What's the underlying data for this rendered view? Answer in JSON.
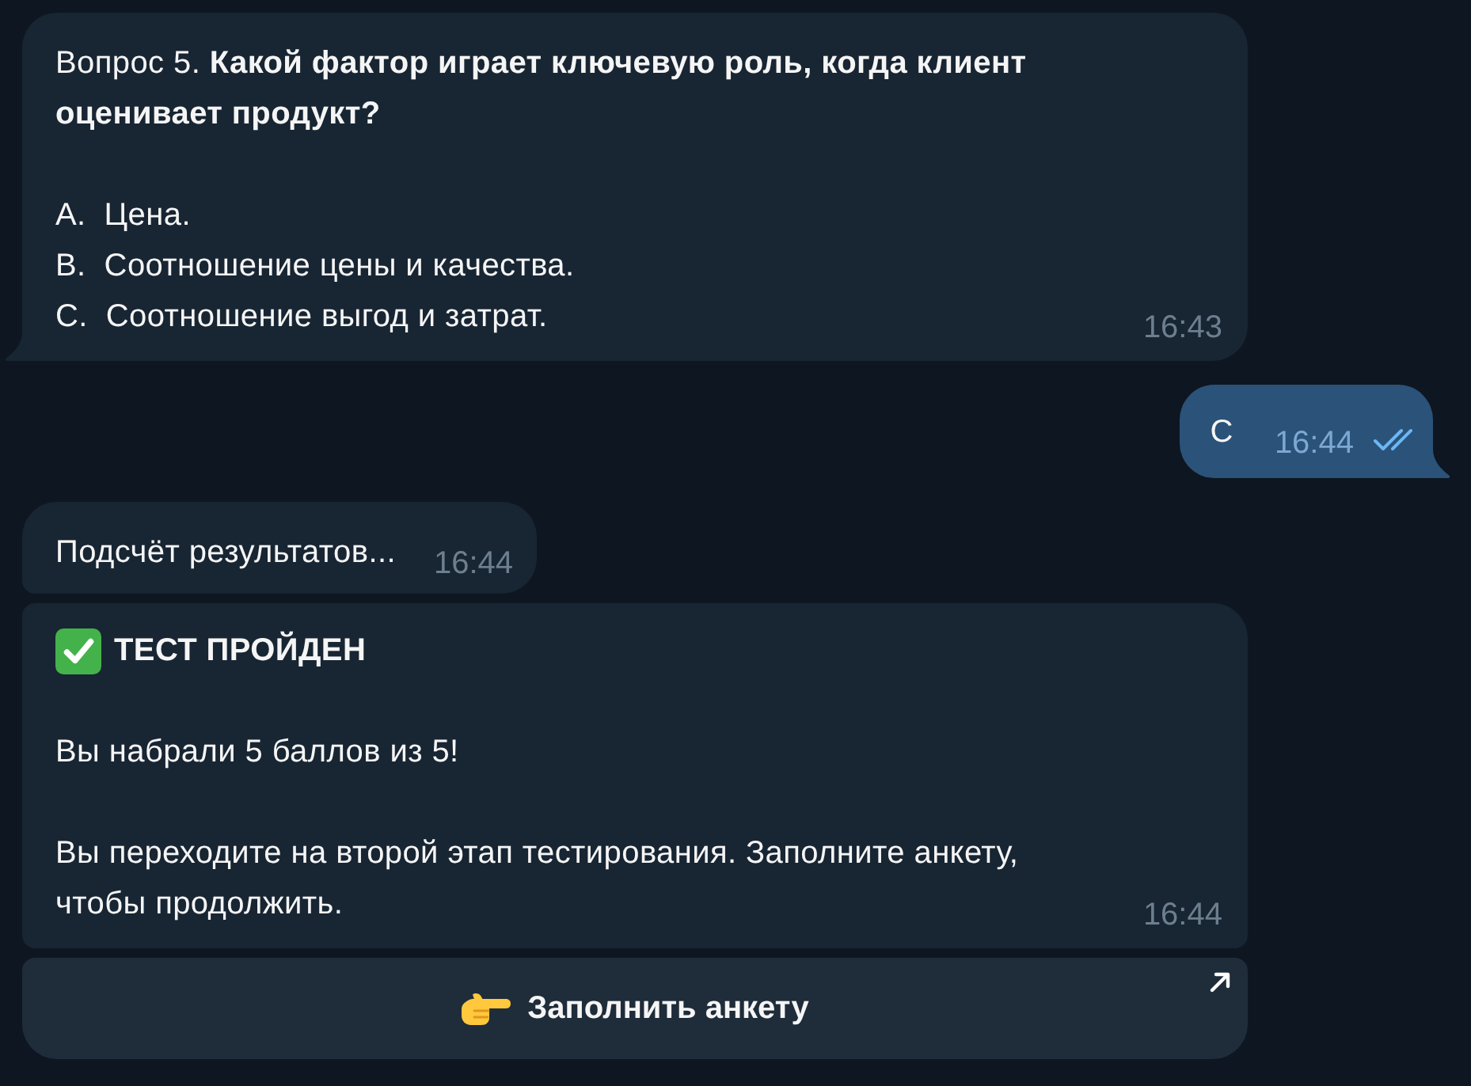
{
  "messages": [
    {
      "kind": "question",
      "outgoing": false,
      "tail": true,
      "question": "Вопрос 5. **Какой фактор играет ключевую роль, когда клиент оценивает продукт?**",
      "options": [
        "A.  Цена.",
        "B.  Соотношение цены и качества.",
        "C.  Соотношение выгод и затрат."
      ],
      "time": "16:43"
    },
    {
      "kind": "answer",
      "outgoing": true,
      "tail": true,
      "text": "C",
      "time": "16:44",
      "read": true
    },
    {
      "kind": "text",
      "outgoing": false,
      "tail": false,
      "text": "Подсчёт результатов...",
      "time": "16:44"
    },
    {
      "kind": "result",
      "outgoing": false,
      "tail": false,
      "title": "ТЕСТ ПРОЙДЕН",
      "paragraphs": [
        "Вы набрали 5 баллов из 5!",
        "Вы переходите на второй этап тестирования. Заполните анкету, чтобы продолжить."
      ],
      "time": "16:44",
      "buttons": [
        {
          "label": "Заполнить анкету",
          "external": true
        }
      ]
    }
  ]
}
